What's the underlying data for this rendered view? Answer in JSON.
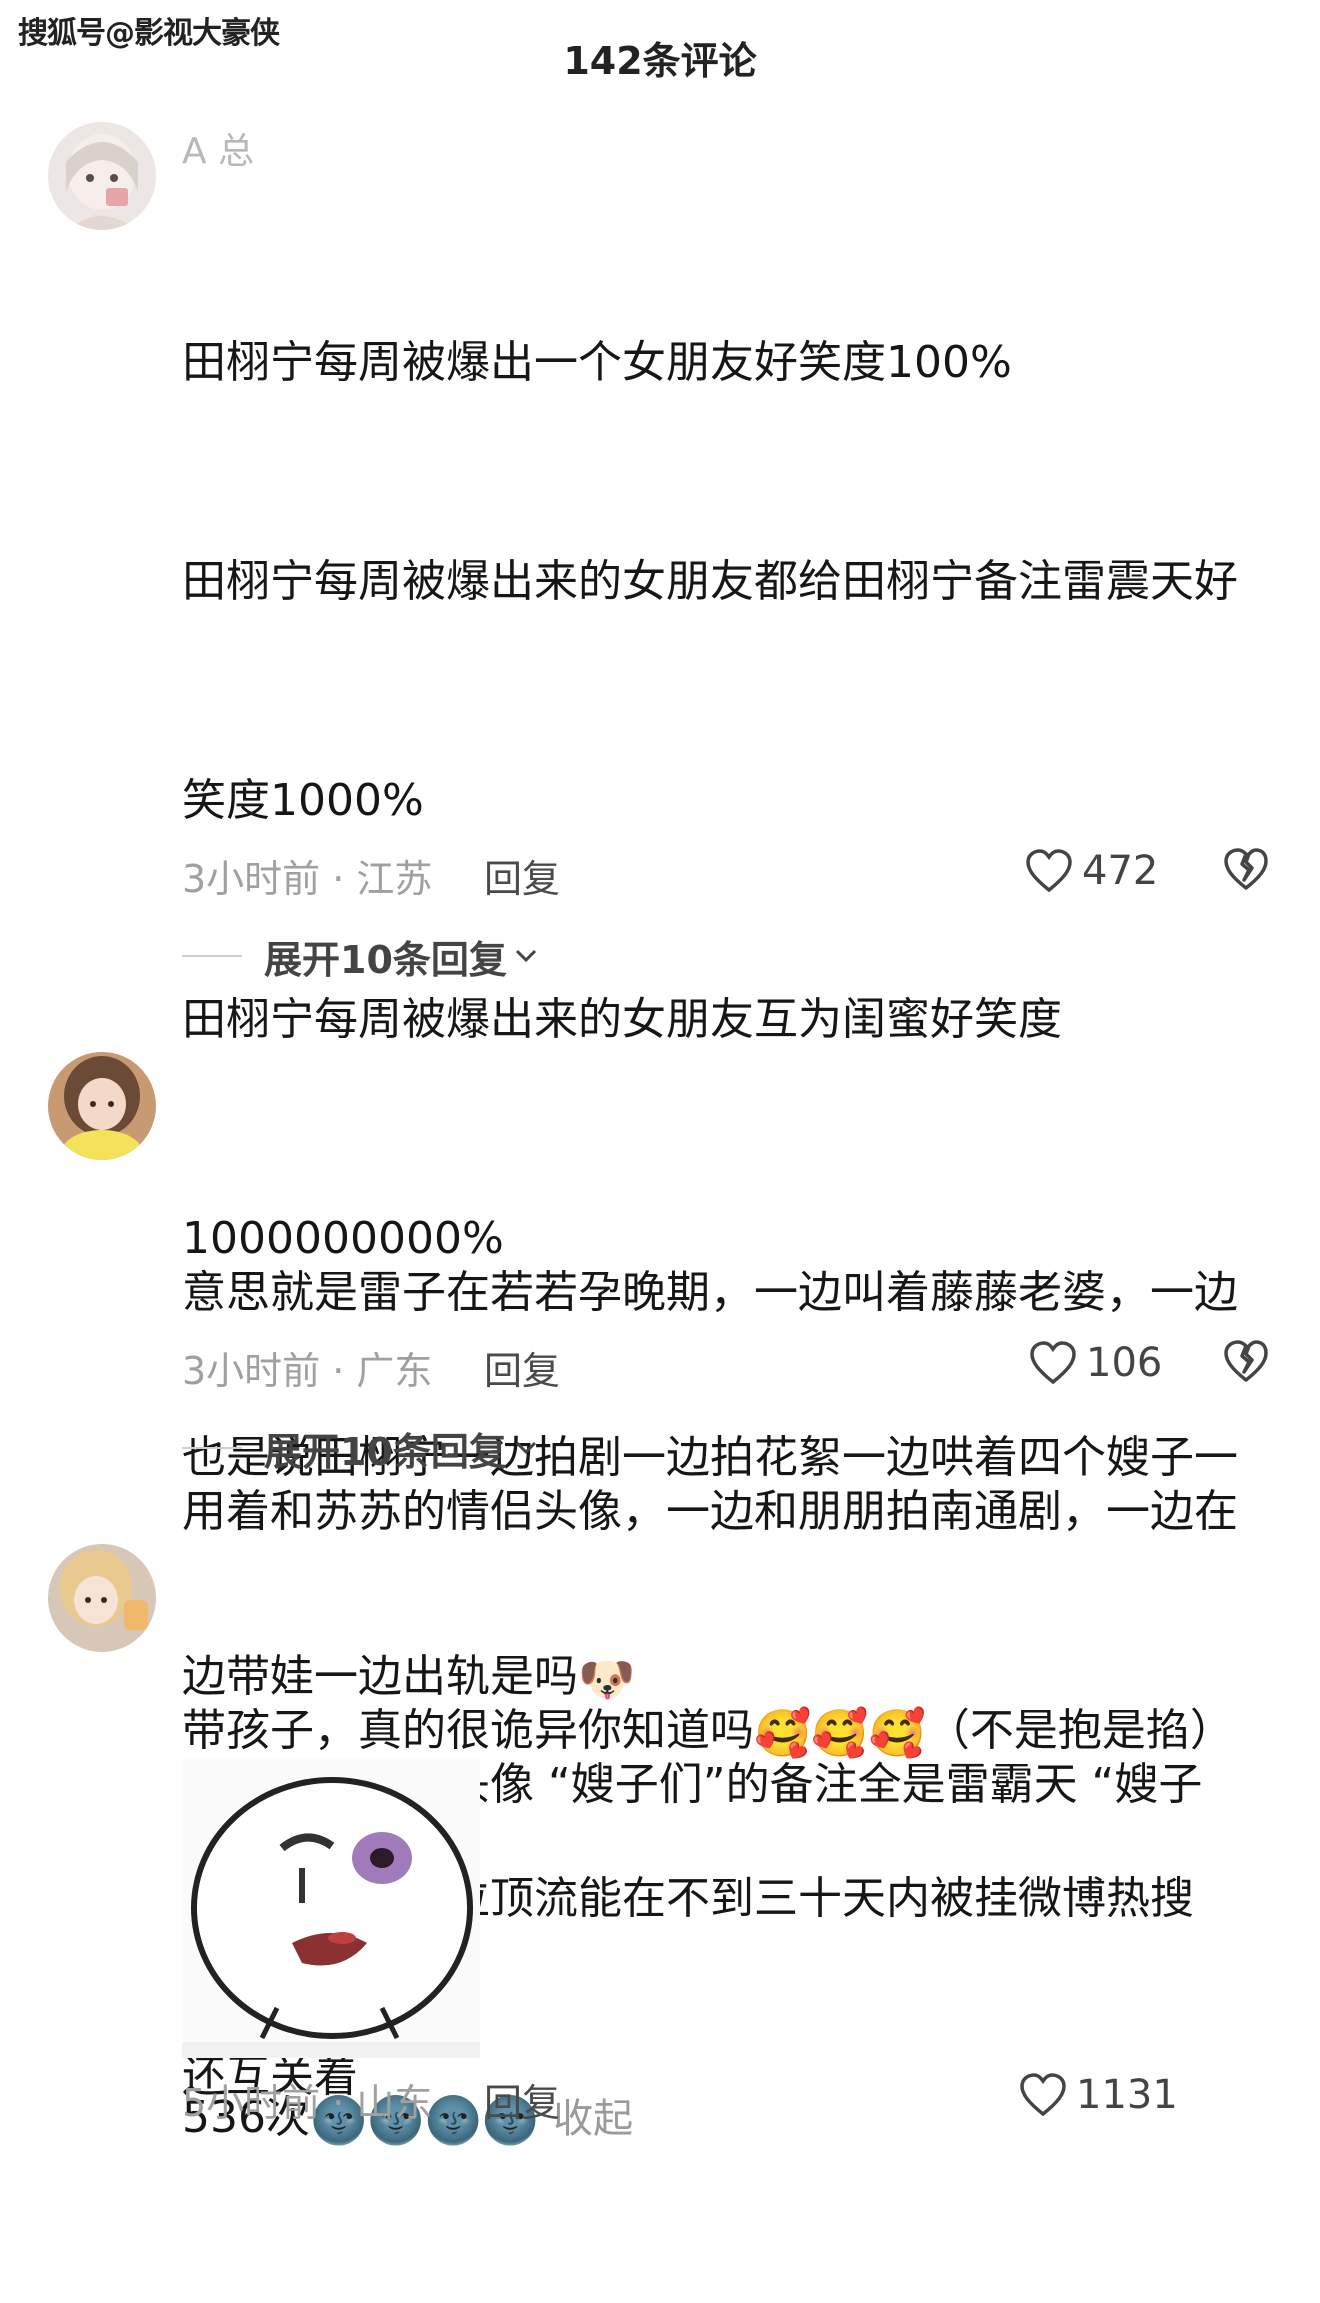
{
  "watermark": "搜狐号@影视大豪侠",
  "header": {
    "title": "142条评论"
  },
  "comments": [
    {
      "username": "A          总",
      "lines": [
        "田栩宁每周被爆出一个女朋友好笑度100%",
        "田栩宁每周被爆出来的女朋友都给田栩宁备注雷震天好",
        "笑度1000%",
        "田栩宁每周被爆出来的女朋友互为闺蜜好笑度",
        "1000000000%",
        "也是说田栩宁一边拍剧一边拍花絮一边哄着四个嫂子一",
        "边带娃一边出轨是吗",
        "试问娱乐圈哪位顶流能在不到三十天内被挂微博热搜",
        "536次"
      ],
      "emoji_line7": "🐶",
      "emoji_line9": "🌚🌚🌚🌚",
      "collapse_label": "收起",
      "time_location": "3小时前 · 江苏",
      "reply_label": "回复",
      "likes": "472",
      "expand_label": "展开10条回复"
    },
    {
      "username": "",
      "lines": [
        "意思就是雷子在若若孕晚期，一边叫着藤藤老婆，一边",
        "用着和苏苏的情侣头像，一边和朋朋拍南通剧，一边在",
        "带孩子，真的很诡异你知道吗"
      ],
      "emoji_line3": "🥰🥰🥰",
      "suffix_line3": "（不是抱是掐）",
      "time_location": "3小时前 · 广东",
      "reply_label": "回复",
      "likes": "106",
      "expand_label": "展开10条回复"
    },
    {
      "username": "",
      "lines": [
        "十年不换一个头像 “嫂子们”的备注全是雷霸天 “嫂子们”",
        "还互关着"
      ],
      "time_location": "5小时前 · 山东",
      "reply_label": "回复",
      "likes": "1131"
    }
  ],
  "colors": {
    "text": "#161616",
    "muted": "#a0a0a0",
    "line": "#cfcfcf"
  }
}
